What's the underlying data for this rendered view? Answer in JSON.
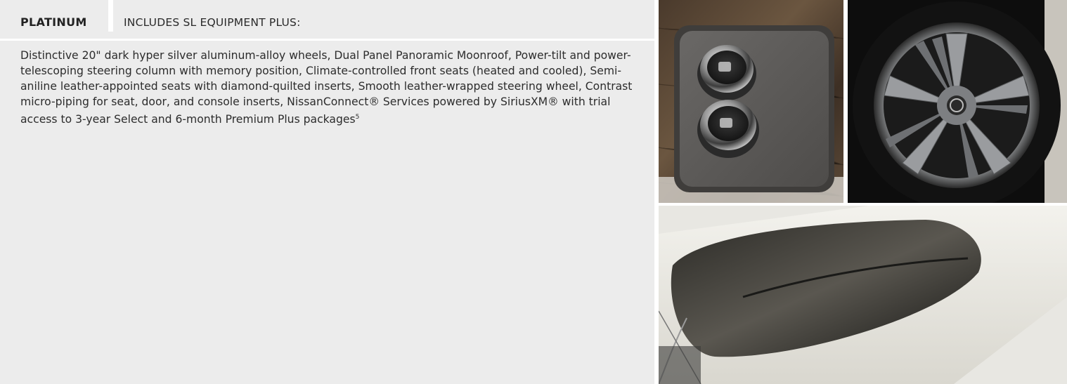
{
  "trim": {
    "name": "PLATINUM",
    "includes": "INCLUDES SL EQUIPMENT PLUS:"
  },
  "description": {
    "text": "Distinctive 20\" dark hyper silver aluminum-alloy wheels, Dual Panel Panoramic Moonroof, Power-tilt and power-telescoping steering column with memory position, Climate-controlled front seats (heated and cooled), Semi-aniline leather-appointed seats with diamond-quilted inserts, Smooth leather-wrapped steering wheel, Contrast micro-piping for seat, door, and console inserts, NissanConnect® Services powered by SiriusXM® with trial access to 3-year Select and 6-month Premium Plus packages",
    "footnote": "5"
  },
  "photos": [
    {
      "icon": "climate-seat-controls-photo"
    },
    {
      "icon": "alloy-wheel-photo"
    },
    {
      "icon": "panoramic-moonroof-photo"
    }
  ],
  "colors": {
    "panel_bg": "#ececec",
    "text": "#2c2c2c"
  }
}
